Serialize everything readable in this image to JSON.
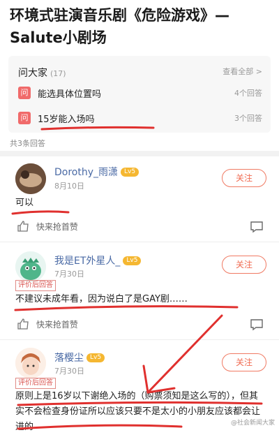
{
  "title": "环境式驻演音乐剧《危险游戏》—Salute小剧场",
  "qa": {
    "heading": "问大家",
    "count": "(17)",
    "view_all": "查看全部 >",
    "questions": [
      {
        "badge": "问",
        "text": "能选具体位置吗",
        "answers": "4个回答"
      },
      {
        "badge": "问",
        "text": "15岁能入场吗",
        "answers": "3个回答"
      }
    ]
  },
  "total_answers": "共3条回答",
  "answers": [
    {
      "user": "Dorothy_雨潇",
      "level": "Lv5",
      "date": "8月10日",
      "follow": "关注",
      "text": "可以",
      "tag": "",
      "like": "快来抢首赞"
    },
    {
      "user": "我是ET外星人_",
      "level": "Lv5",
      "date": "7月30日",
      "follow": "关注",
      "tag": "评价后回答",
      "text": "不建议未成年看，因为说白了是GAY剧……",
      "like": "快来抢首赞"
    },
    {
      "user": "落樱尘",
      "level": "Lv5",
      "date": "7月30日",
      "follow": "关注",
      "tag": "评价后回答",
      "text": "原则上是16岁以下谢绝入场的（购票须知是这么写的），但其实不会检查身份证所以应该只要不是太小的小朋友应该都会让进的",
      "like": ""
    }
  ],
  "watermark": "@社会新闻大家",
  "colors": {
    "accent": "#f06a50",
    "username": "#4a6aa5",
    "badge": "#f06a6a",
    "annotation": "#e0302e"
  }
}
